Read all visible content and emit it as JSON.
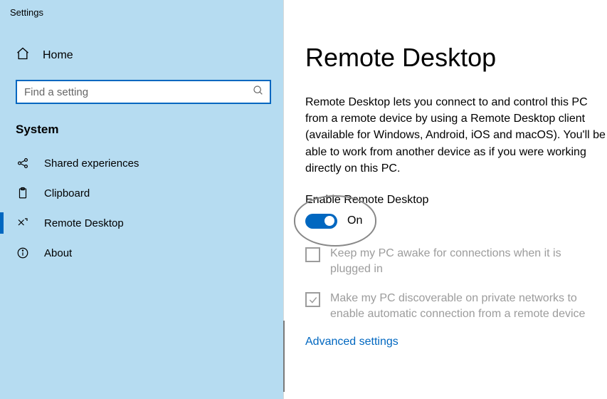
{
  "app_title": "Settings",
  "sidebar": {
    "home_label": "Home",
    "search_placeholder": "Find a setting",
    "section_title": "System",
    "items": [
      {
        "label": "Shared experiences"
      },
      {
        "label": "Clipboard"
      },
      {
        "label": "Remote Desktop"
      },
      {
        "label": "About"
      }
    ]
  },
  "main": {
    "heading": "Remote Desktop",
    "description": "Remote Desktop lets you connect to and control this PC from a remote device by using a Remote Desktop client (available for Windows, Android, iOS and macOS). You'll be able to work from another device as if you were working directly on this PC.",
    "enable_label": "Enable Remote Desktop",
    "toggle_state": "On",
    "option_keep_awake": "Keep my PC awake for connections when it is plugged in",
    "option_discoverable": "Make my PC discoverable on private networks to enable automatic connection from a remote device",
    "advanced_link": "Advanced settings"
  }
}
